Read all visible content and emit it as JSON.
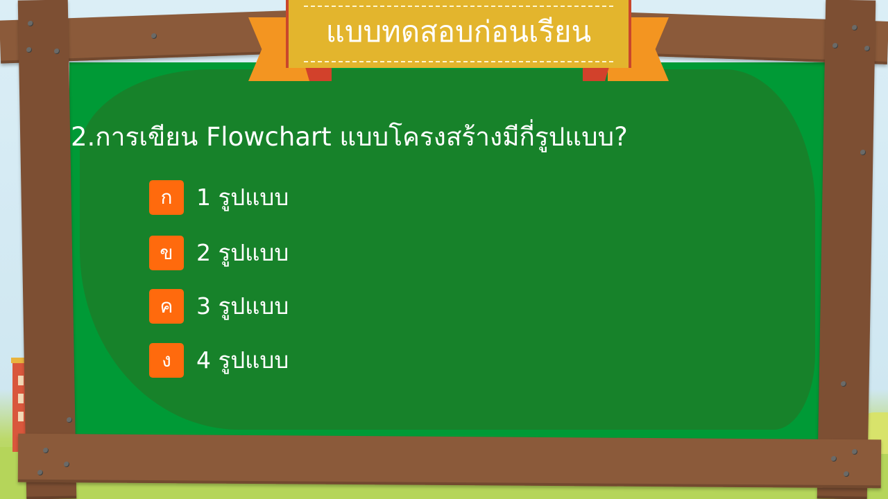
{
  "slide": {
    "banner_title": "แบบทดสอบก่อนเรียน",
    "question": "2.การเขียน Flowchart แบบโครงสร้างมีกี่รูปแบบ?",
    "options": [
      {
        "letter": "ก",
        "text": "1  รูปแบบ"
      },
      {
        "letter": "ข",
        "text": "2  รูปแบบ"
      },
      {
        "letter": "ค",
        "text": "3  รูปแบบ"
      },
      {
        "letter": "ง",
        "text": "4  รูปแบบ"
      }
    ]
  },
  "colors": {
    "board": "#009a36",
    "wood": "#8b5a3a",
    "banner": "#e3b52d",
    "ribbon": "#f39521",
    "option_box": "#ff6a0d"
  }
}
